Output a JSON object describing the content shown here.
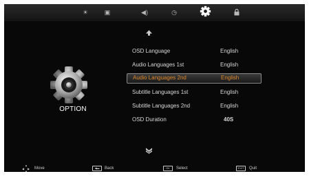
{
  "top_tabs": [
    {
      "icon": "picture-icon",
      "glyph": "☀"
    },
    {
      "icon": "screen-icon",
      "glyph": "▣"
    },
    {
      "icon": "sound-icon",
      "glyph": "◀)"
    },
    {
      "icon": "clock-icon",
      "glyph": "◷"
    },
    {
      "icon": "option-gear-icon",
      "glyph": "✲"
    },
    {
      "icon": "lock-icon",
      "glyph": "🔒"
    }
  ],
  "active_tab": 4,
  "section": {
    "title": "OPTION",
    "icon": "gear-icon"
  },
  "menu": [
    {
      "label": "OSD Language",
      "value": "English"
    },
    {
      "label": "Audio Languages 1st",
      "value": "English"
    },
    {
      "label": "Audio Languages 2nd",
      "value": "English"
    },
    {
      "label": "Subtitle Languages 1st",
      "value": "English"
    },
    {
      "label": "Subtitle Languages 2nd",
      "value": "English"
    },
    {
      "label": "OSD Duration",
      "value": "40S"
    }
  ],
  "selected_index": 2,
  "footer": {
    "move": "Move",
    "back": "Back",
    "select": "Select",
    "quit": "Quit"
  },
  "colors": {
    "highlight_text": "#e08a2c",
    "background": "#080808",
    "text": "#d8d8d8"
  }
}
